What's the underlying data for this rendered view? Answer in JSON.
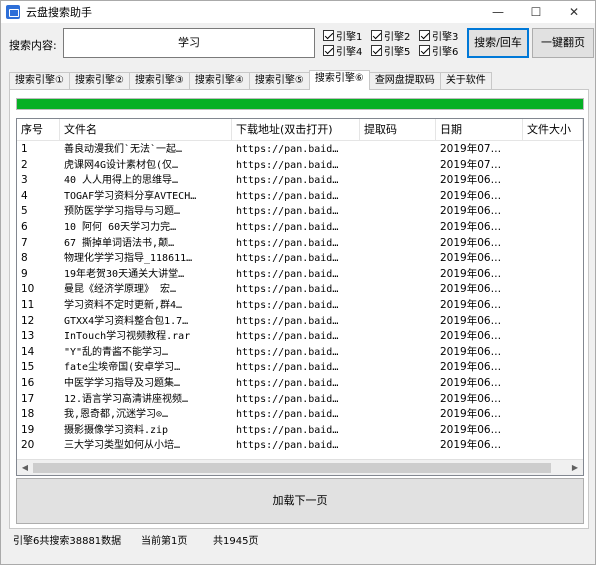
{
  "window": {
    "title": "云盘搜索助手",
    "minimize": "—",
    "maximize": "☐",
    "close": "✕"
  },
  "search": {
    "label": "搜索内容:",
    "value": "学习"
  },
  "engines": [
    {
      "label": "引擎1",
      "checked": true
    },
    {
      "label": "引擎2",
      "checked": true
    },
    {
      "label": "引擎3",
      "checked": true
    },
    {
      "label": "引擎4",
      "checked": true
    },
    {
      "label": "引擎5",
      "checked": true
    },
    {
      "label": "引擎6",
      "checked": true
    }
  ],
  "buttons": {
    "search": "搜索/回车",
    "flip": "一键翻页",
    "load_next": "加载下一页"
  },
  "tabs": [
    "搜索引擎①",
    "搜索引擎②",
    "搜索引擎③",
    "搜索引擎④",
    "搜索引擎⑤",
    "搜索引擎⑥",
    "查网盘提取码",
    "关于软件"
  ],
  "active_tab": 5,
  "progress": 1.0,
  "table": {
    "columns": [
      "序号",
      "文件名",
      "下载地址(双击打开)",
      "提取码",
      "日期",
      "文件大小"
    ],
    "rows": [
      [
        "1",
        "善良动漫我们`无法`一起…",
        "https://pan.baid…",
        "",
        "2019年07…"
      ],
      [
        "2",
        "虎课网4G设计素材包(仅…",
        "https://pan.baid…",
        "",
        "2019年07…"
      ],
      [
        "3",
        "40  人人用得上的思维导…",
        "https://pan.baid…",
        "",
        "2019年06…"
      ],
      [
        "4",
        "TOGAF学习资料分享AVTECH…",
        "https://pan.baid…",
        "",
        "2019年06…"
      ],
      [
        "5",
        "预防医学学习指导与习题…",
        "https://pan.baid…",
        "",
        "2019年06…"
      ],
      [
        "6",
        "10  阿何 60天学习力完…",
        "https://pan.baid…",
        "",
        "2019年06…"
      ],
      [
        "7",
        "67  撕掉单词语法书,颠…",
        "https://pan.baid…",
        "",
        "2019年06…"
      ],
      [
        "8",
        "物理化学学习指导_118611…",
        "https://pan.baid…",
        "",
        "2019年06…"
      ],
      [
        "9",
        "19年老贺30天通关大讲堂…",
        "https://pan.baid…",
        "",
        "2019年06…"
      ],
      [
        "10",
        "曼昆《经济学原理》  宏…",
        "https://pan.baid…",
        "",
        "2019年06…"
      ],
      [
        "11",
        "学习资料不定时更新,群4…",
        "https://pan.baid…",
        "",
        "2019年06…"
      ],
      [
        "12",
        "GTXX4学习资料整合包1.7…",
        "https://pan.baid…",
        "",
        "2019年06…"
      ],
      [
        "13",
        "InTouch学习视频教程.rar",
        "https://pan.baid…",
        "",
        "2019年06…"
      ],
      [
        "14",
        "\"Y\"乱的青酱不能学习…",
        "https://pan.baid…",
        "",
        "2019年06…"
      ],
      [
        "15",
        "fate尘埃帝国(安卓学习…",
        "https://pan.baid…",
        "",
        "2019年06…"
      ],
      [
        "16",
        "中医学学习指导及习题集…",
        "https://pan.baid…",
        "",
        "2019年06…"
      ],
      [
        "17",
        "12.语言学习高清讲座视频…",
        "https://pan.baid…",
        "",
        "2019年06…"
      ],
      [
        "18",
        "我,恩奇都,沉迷学习⊙…",
        "https://pan.baid…",
        "",
        "2019年06…"
      ],
      [
        "19",
        "摄影摄像学习资料.zip",
        "https://pan.baid…",
        "",
        "2019年06…"
      ],
      [
        "20",
        "三大学习类型如何从小培…",
        "https://pan.baid…",
        "",
        "2019年06…"
      ]
    ]
  },
  "status": {
    "total": "引擎6共搜索38881数据",
    "current_page": "当前第1页",
    "total_pages": "共1945页"
  },
  "colors": {
    "progress": "#06b025",
    "accent": "#0078d7"
  }
}
